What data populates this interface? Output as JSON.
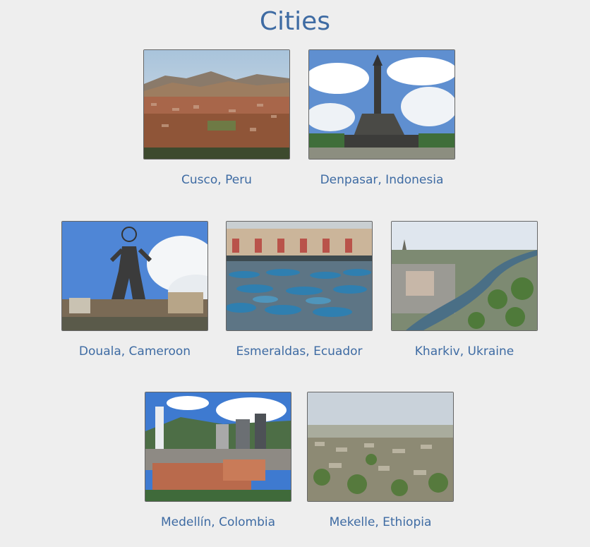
{
  "page": {
    "title": "Cities"
  },
  "cities": [
    {
      "label": "Cusco, Peru",
      "image": "cusco-photo"
    },
    {
      "label": "Denpasar, Indonesia",
      "image": "denpasar-photo"
    },
    {
      "label": "Douala, Cameroon",
      "image": "douala-photo"
    },
    {
      "label": "Esmeraldas, Ecuador",
      "image": "esmeraldas-photo"
    },
    {
      "label": "Kharkiv, Ukraine",
      "image": "kharkiv-photo"
    },
    {
      "label": "Medellín, Colombia",
      "image": "medellin-photo"
    },
    {
      "label": "Mekelle, Ethiopia",
      "image": "mekelle-photo"
    }
  ]
}
